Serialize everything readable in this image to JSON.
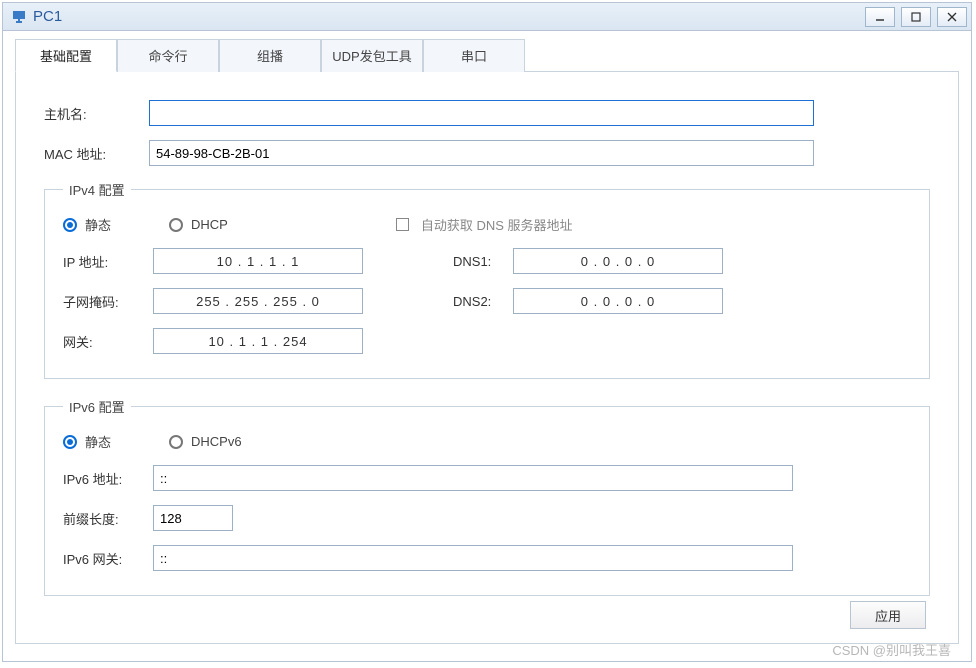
{
  "window": {
    "title": "PC1"
  },
  "tabs": [
    "基础配置",
    "命令行",
    "组播",
    "UDP发包工具",
    "串口"
  ],
  "activeTab": 0,
  "basic": {
    "hostLabel": "主机名:",
    "hostValue": "",
    "macLabel": "MAC 地址:",
    "macValue": "54-89-98-CB-2B-01"
  },
  "ipv4": {
    "legend": "IPv4 配置",
    "staticLabel": "静态",
    "dhcpLabel": "DHCP",
    "autoDnsLabel": "自动获取 DNS 服务器地址",
    "ipLabel": "IP 地址:",
    "ipValue": "10  .  1  .  1  .  1",
    "maskLabel": "子网掩码:",
    "maskValue": "255  . 255  . 255  .  0",
    "gwLabel": "网关:",
    "gwValue": "10  .  1  .  1  . 254",
    "dns1Label": "DNS1:",
    "dns1Value": "0  .  0  .  0  .  0",
    "dns2Label": "DNS2:",
    "dns2Value": "0  .  0  .  0  .  0"
  },
  "ipv6": {
    "legend": "IPv6 配置",
    "staticLabel": "静态",
    "dhcpLabel": "DHCPv6",
    "addrLabel": "IPv6 地址:",
    "addrValue": "::",
    "prefixLabel": "前缀长度:",
    "prefixValue": "128",
    "gwLabel": "IPv6 网关:",
    "gwValue": "::"
  },
  "applyLabel": "应用",
  "watermark": "CSDN @别叫我王喜"
}
